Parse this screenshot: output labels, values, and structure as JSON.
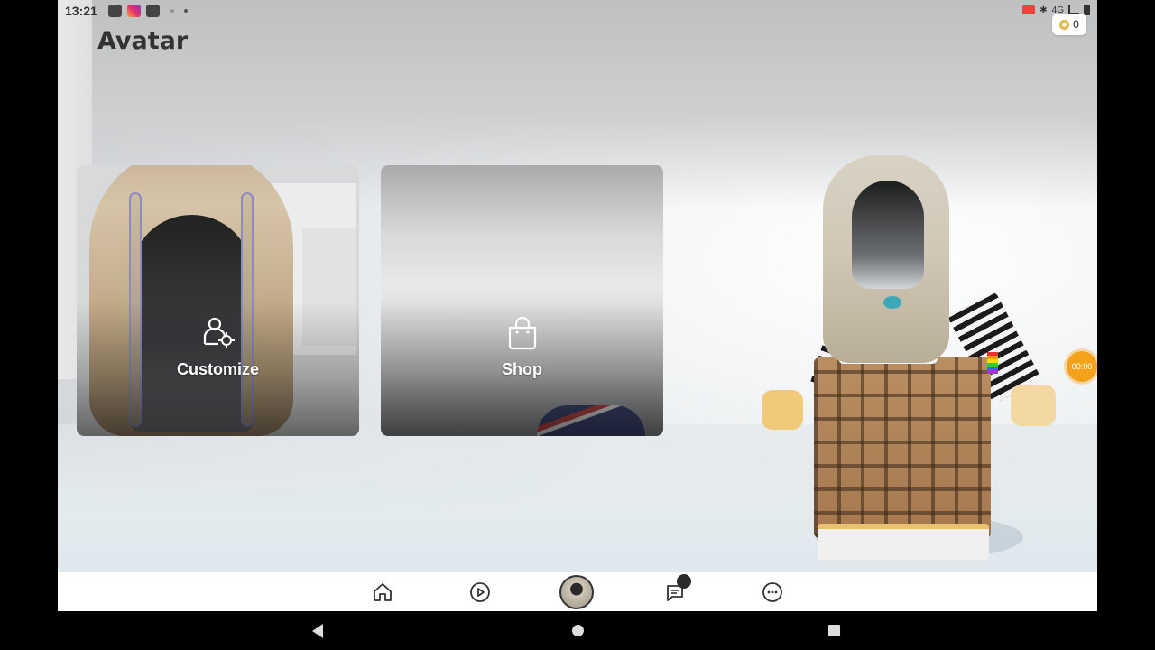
{
  "status_bar": {
    "time": "13:21",
    "network": "4G"
  },
  "header": {
    "title": "Avatar",
    "robux_balance": "0"
  },
  "cards": {
    "customize": {
      "label": "Customize",
      "icon": "customize-avatar-icon"
    },
    "shop": {
      "label": "Shop",
      "icon": "shopping-bag-icon"
    }
  },
  "recording": {
    "timer": "00:00",
    "color": "#f4a21b"
  },
  "bottom_nav": {
    "items": [
      {
        "name": "home",
        "icon": "home-icon"
      },
      {
        "name": "discover",
        "icon": "play-icon"
      },
      {
        "name": "avatar",
        "icon": "avatar-thumbnail"
      },
      {
        "name": "chat",
        "icon": "chat-icon",
        "has_notification": true
      },
      {
        "name": "more",
        "icon": "more-icon"
      }
    ]
  },
  "android_nav": {
    "icons": [
      "back-icon",
      "home-circle-icon",
      "recents-icon"
    ]
  }
}
